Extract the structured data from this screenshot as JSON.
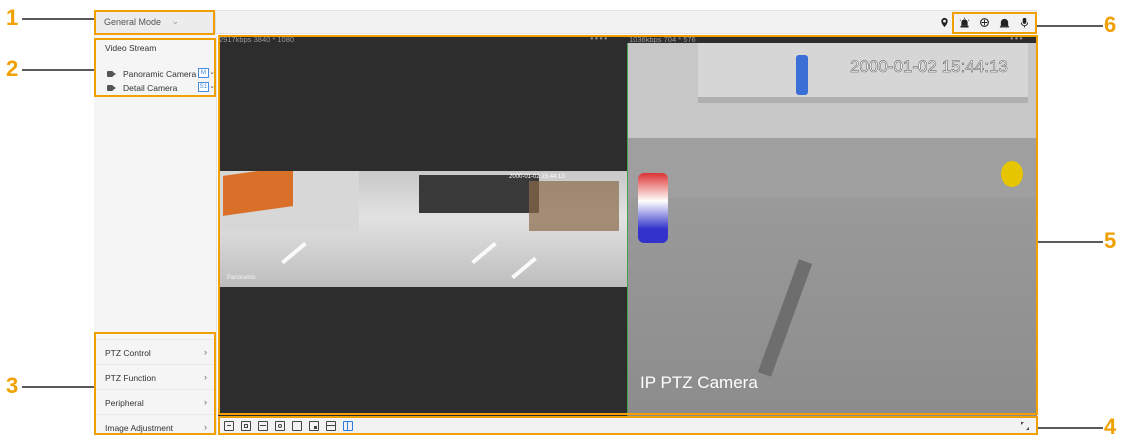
{
  "callouts": [
    "1",
    "2",
    "3",
    "4",
    "5",
    "6"
  ],
  "topbar": {
    "mode_label": "General Mode",
    "icons": [
      "location-icon",
      "alarm-light-icon",
      "ptz-rotate-icon",
      "siren-icon",
      "microphone-icon"
    ]
  },
  "left_panel": {
    "video_stream_title": "Video Stream",
    "cameras": [
      {
        "label": "Panoramic Camera",
        "stream": "M"
      },
      {
        "label": "Detail Camera",
        "stream": "S1"
      }
    ],
    "menu": [
      {
        "label": "PTZ Control"
      },
      {
        "label": "PTZ Function"
      },
      {
        "label": "Peripheral"
      },
      {
        "label": "Image Adjustment"
      }
    ]
  },
  "video": {
    "panoramic": {
      "status": "2917kbps  3840 * 1080",
      "timestamp": "2000-01-02 15:44:13",
      "overlay_label": "Panoramic"
    },
    "detail": {
      "status": "1036kbps  704 * 576",
      "timestamp": "2000-01-02 15:44:13",
      "overlay_label": "IP PTZ Camera"
    }
  },
  "bottombar": {
    "icons": [
      "original-size-icon",
      "zoom-icon",
      "draw-rule-icon",
      "face-detect-icon",
      "single-view-icon",
      "pip-view-icon",
      "two-row-view-icon",
      "split-view-icon"
    ],
    "active_icon": "split-view-icon"
  },
  "colors": {
    "callout": "#f0a000",
    "accent": "#2b7de0",
    "frame_border": "#4aa04a"
  }
}
